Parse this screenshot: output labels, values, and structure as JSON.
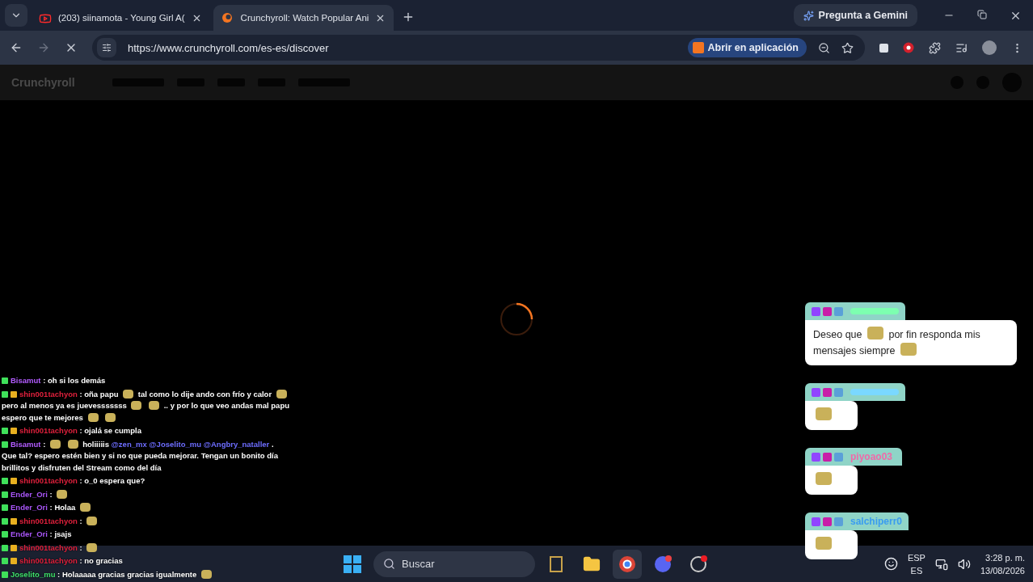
{
  "tabs": [
    {
      "title": "(203) siinamota - Young Girl A(",
      "selected": false,
      "kind": "video"
    },
    {
      "title": "Crunchyroll: Watch Popular Ani",
      "selected": true,
      "kind": "site"
    }
  ],
  "gemini": {
    "label": "Pregunta a Gemini"
  },
  "address_bar": {
    "url": "https://www.crunchyroll.com/es-es/discover",
    "open_app": "Abrir en aplicación"
  },
  "page": {
    "logo": "Crunchyroll",
    "loading": true
  },
  "chat_left": [
    {
      "user": "Bisamut",
      "sep": ":",
      "color": "#b35cff",
      "crown": false,
      "parts": [
        {
          "kind": "text",
          "text": "oh si los demás"
        }
      ]
    },
    {
      "user": "shin001tachyon",
      "sep": ":",
      "color": "#e0203c",
      "crown": true,
      "parts": [
        {
          "kind": "text",
          "text": "oña papu"
        },
        {
          "kind": "emote"
        },
        {
          "kind": "text",
          "text": "tal como lo dije ando con frío y calor"
        },
        {
          "kind": "emote"
        },
        {
          "kind": "text",
          "text": "pero al menos ya es juevesssssss"
        },
        {
          "kind": "emote"
        },
        {
          "kind": "emote"
        },
        {
          "kind": "text",
          "text": ".. y por lo que veo andas mal papu espero que te mejores"
        },
        {
          "kind": "emote"
        },
        {
          "kind": "emote"
        }
      ]
    },
    {
      "user": "shin001tachyon",
      "sep": ":",
      "color": "#e0203c",
      "crown": true,
      "parts": [
        {
          "kind": "text",
          "text": "ojalá se cumpla"
        }
      ]
    },
    {
      "user": "Bisamut",
      "sep": ":",
      "color": "#b35cff",
      "crown": false,
      "parts": [
        {
          "kind": "emote"
        },
        {
          "kind": "emote"
        },
        {
          "kind": "text",
          "text": "holiiiiis"
        },
        {
          "kind": "mention",
          "text": "@zen_mx"
        },
        {
          "kind": "mention",
          "text": "@Joselito_mu"
        },
        {
          "kind": "mention",
          "text": "@Angbry_nataller"
        },
        {
          "kind": "text",
          "text": ". Que tal? espero estén bien y si no que pueda mejorar. Tengan un bonito día brillitos y disfruten del Stream como del día"
        }
      ]
    },
    {
      "user": "shin001tachyon",
      "sep": ":",
      "color": "#e0203c",
      "crown": true,
      "parts": [
        {
          "kind": "text",
          "text": "o_0 espera que?"
        }
      ]
    },
    {
      "user": "Ender_Ori",
      "sep": ":",
      "color": "#a855f7",
      "crown": false,
      "parts": [
        {
          "kind": "emote"
        }
      ]
    },
    {
      "user": "Ender_Ori",
      "sep": ":",
      "color": "#a855f7",
      "crown": false,
      "parts": [
        {
          "kind": "text",
          "text": "Holaa"
        },
        {
          "kind": "emote"
        }
      ]
    },
    {
      "user": "shin001tachyon",
      "sep": ":",
      "color": "#e0203c",
      "crown": true,
      "parts": [
        {
          "kind": "emote"
        }
      ]
    },
    {
      "user": "Ender_Ori",
      "sep": ":",
      "color": "#a855f7",
      "crown": false,
      "parts": [
        {
          "kind": "text",
          "text": "jsajs"
        }
      ]
    },
    {
      "user": "shin001tachyon",
      "sep": ":",
      "color": "#e0203c",
      "crown": true,
      "parts": [
        {
          "kind": "emote"
        }
      ]
    },
    {
      "user": "shin001tachyon",
      "sep": ":",
      "color": "#e0203c",
      "crown": true,
      "parts": [
        {
          "kind": "text",
          "text": "no gracias"
        }
      ]
    },
    {
      "user": "Joselito_mu",
      "sep": ":",
      "color": "#3ee06a",
      "crown": false,
      "parts": [
        {
          "kind": "text",
          "text": "Holaaaaa gracias gracias igualmente"
        },
        {
          "kind": "emote"
        }
      ]
    }
  ],
  "chat_right": [
    {
      "color": "#7dffb0",
      "parts": [
        {
          "kind": "text",
          "text": "Deseo que"
        },
        {
          "kind": "emote"
        },
        {
          "kind": "text",
          "text": "por fin responda mis mensajes siempre"
        },
        {
          "kind": "emote"
        }
      ]
    },
    {
      "color": "#7ad8ff",
      "parts": [
        {
          "kind": "emote"
        }
      ]
    },
    {
      "user": "piyoao03",
      "color": "#f06aa8",
      "parts": [
        {
          "kind": "emote"
        }
      ]
    },
    {
      "user": "salchiperr0",
      "color": "#3a9cf0",
      "parts": [
        {
          "kind": "emote"
        }
      ]
    }
  ],
  "taskbar": {
    "search_placeholder": "Buscar",
    "language": "ESP",
    "layout": "ES",
    "time": "3:28 p. m.",
    "date": "13/08/2026"
  }
}
